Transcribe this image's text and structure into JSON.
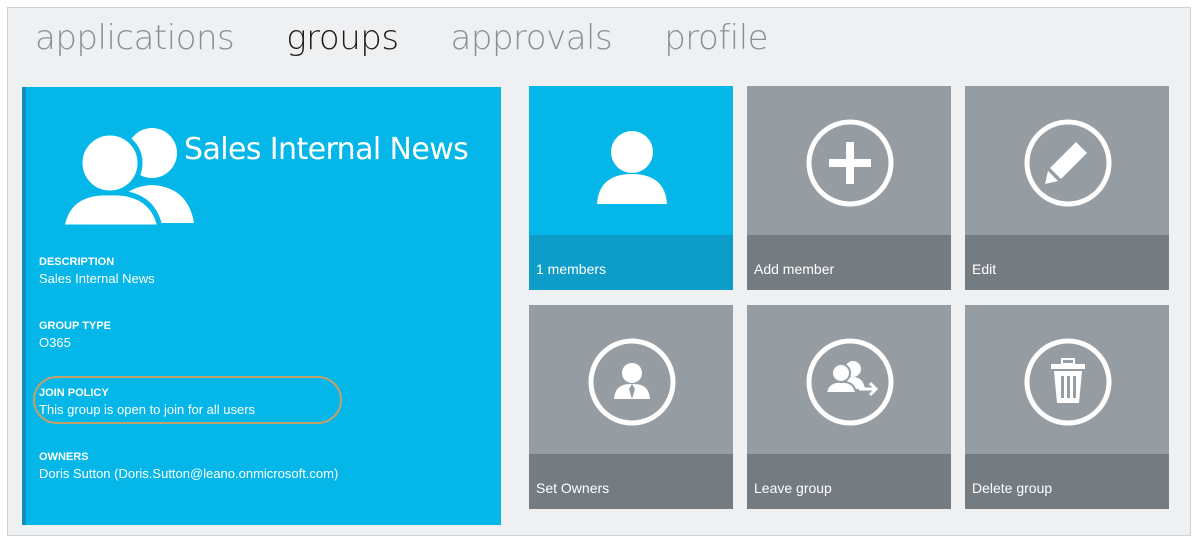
{
  "nav": {
    "items": [
      "applications",
      "groups",
      "approvals",
      "profile"
    ],
    "active": "groups"
  },
  "group": {
    "title": "Sales Internal News",
    "icon": "group-people-icon",
    "fields": {
      "description": {
        "label": "DESCRIPTION",
        "value": "Sales Internal News"
      },
      "group_type": {
        "label": "GROUP TYPE",
        "value": "O365"
      },
      "join_policy": {
        "label": "JOIN POLICY",
        "value": "This group is open to join for all users"
      },
      "owners": {
        "label": "OWNERS",
        "value": "Doris Sutton (Doris.Sutton@leano.onmicrosoft.com)"
      }
    }
  },
  "tiles": [
    {
      "label": "1 members",
      "icon": "person-icon"
    },
    {
      "label": "Add member",
      "icon": "plus-circle-icon"
    },
    {
      "label": "Edit",
      "icon": "pencil-circle-icon"
    },
    {
      "label": "Set Owners",
      "icon": "owner-circle-icon"
    },
    {
      "label": "Leave group",
      "icon": "leave-group-circle-icon"
    },
    {
      "label": "Delete group",
      "icon": "trash-circle-icon"
    }
  ],
  "colors": {
    "accent": "#05b7e9",
    "accent_dark": "#0d9dc8",
    "tile_gray": "#959da3",
    "tile_footer_gray": "#747c82",
    "highlight_ring": "#c2a068"
  }
}
